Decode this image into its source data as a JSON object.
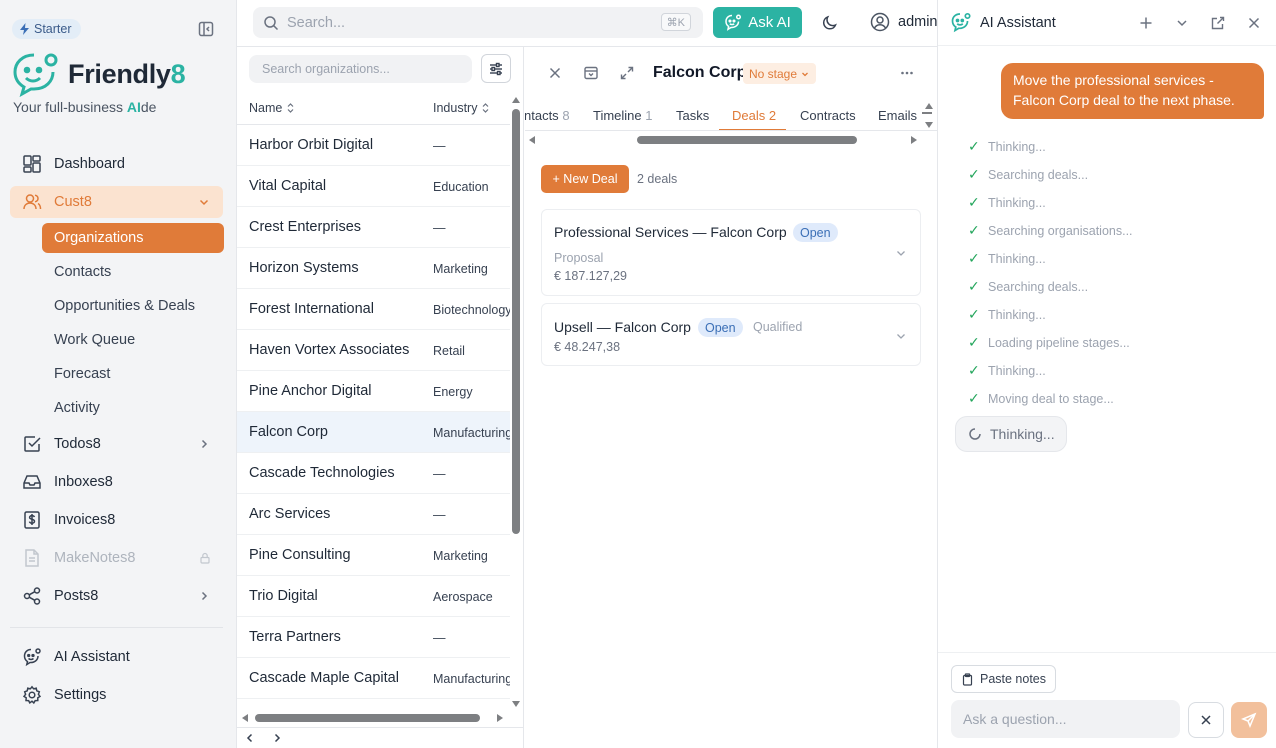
{
  "sidebar": {
    "plan": "Starter",
    "brand": {
      "name_main": "Friendly",
      "name_accent": "8",
      "tagline_pre": "Your full-business ",
      "tagline_ai": "AI",
      "tagline_post": "de"
    },
    "nav": {
      "dashboard": "Dashboard",
      "cust8": "Cust8",
      "sub": [
        "Organizations",
        "Contacts",
        "Opportunities & Deals",
        "Work Queue",
        "Forecast",
        "Activity"
      ],
      "todos8": "Todos8",
      "inboxes8": "Inboxes8",
      "invoices8": "Invoices8",
      "makenotes8": "MakeNotes8",
      "posts8": "Posts8",
      "ai_assistant": "AI Assistant",
      "settings": "Settings"
    }
  },
  "topbar": {
    "search_placeholder": "Search...",
    "shortcut": "⌘K",
    "ask_ai": "Ask AI",
    "user": "admin"
  },
  "org_list": {
    "search_placeholder": "Search organizations...",
    "col_name": "Name",
    "col_industry": "Industry",
    "rows": [
      {
        "name": "Harbor Orbit Digital",
        "industry": "—"
      },
      {
        "name": "Vital Capital",
        "industry": "Education"
      },
      {
        "name": "Crest Enterprises",
        "industry": "—"
      },
      {
        "name": "Horizon Systems",
        "industry": "Marketing"
      },
      {
        "name": "Forest International",
        "industry": "Biotechnology"
      },
      {
        "name": "Haven Vortex Associates",
        "industry": "Retail"
      },
      {
        "name": "Pine Anchor Digital",
        "industry": "Energy"
      },
      {
        "name": "Falcon Corp",
        "industry": "Manufacturing"
      },
      {
        "name": "Cascade Technologies",
        "industry": "—"
      },
      {
        "name": "Arc Services",
        "industry": "—"
      },
      {
        "name": "Pine Consulting",
        "industry": "Marketing"
      },
      {
        "name": "Trio Digital",
        "industry": "Aerospace"
      },
      {
        "name": "Terra Partners",
        "industry": "—"
      },
      {
        "name": "Cascade Maple Capital",
        "industry": "Manufacturing"
      }
    ]
  },
  "detail": {
    "title": "Falcon Corp",
    "stage": "No stage",
    "tabs": [
      {
        "label": "ntacts",
        "count": "8"
      },
      {
        "label": "Timeline",
        "count": "1"
      },
      {
        "label": "Tasks",
        "count": ""
      },
      {
        "label": "Deals",
        "count": "2"
      },
      {
        "label": "Contracts",
        "count": ""
      },
      {
        "label": "Emails",
        "count": ""
      }
    ],
    "new_deal": "+ New Deal",
    "deal_count": "2 deals",
    "deals": [
      {
        "title": "Professional Services — Falcon Corp",
        "status": "Open",
        "stage": "Proposal",
        "amount": "€ 187.127,29"
      },
      {
        "title": "Upsell — Falcon Corp",
        "status": "Open",
        "stage": "Qualified",
        "amount": "€ 48.247,38"
      }
    ]
  },
  "ai": {
    "title": "AI Assistant",
    "user_message": "Move the professional services - Falcon Corp deal to the next phase.",
    "steps": [
      "Thinking...",
      "Searching deals...",
      "Thinking...",
      "Searching organisations...",
      "Thinking...",
      "Searching deals...",
      "Thinking...",
      "Loading pipeline stages...",
      "Thinking...",
      "Moving deal to stage..."
    ],
    "thinking": "Thinking...",
    "paste_notes": "Paste notes",
    "input_placeholder": "Ask a question..."
  },
  "colors": {
    "accent": "#e07b39",
    "teal": "#2bb3a3",
    "sidebar_bg": "#f3f4f6"
  }
}
